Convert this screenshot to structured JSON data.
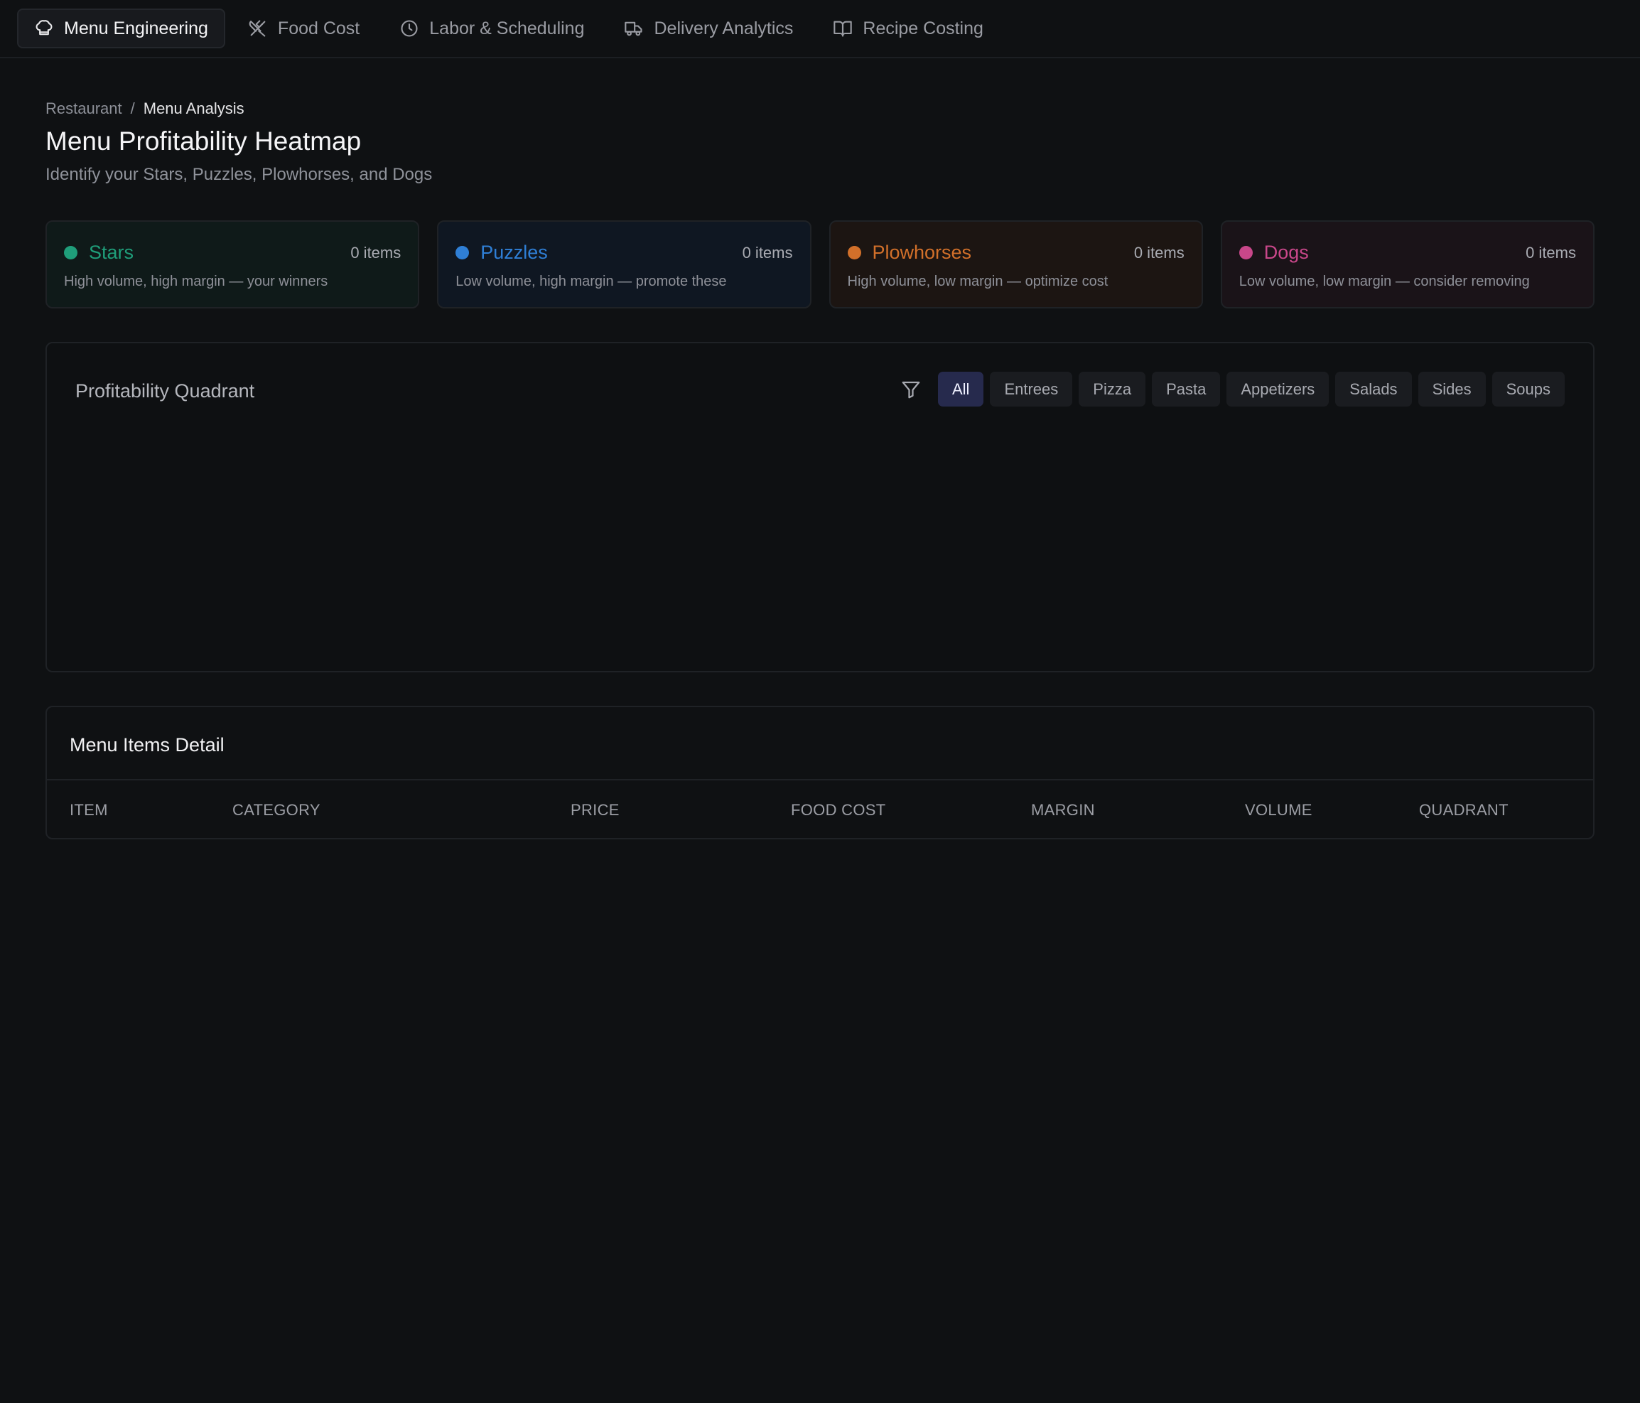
{
  "nav": {
    "tabs": [
      {
        "label": "Menu Engineering",
        "icon": "chef-hat-icon",
        "active": true
      },
      {
        "label": "Food Cost",
        "icon": "utensils-crossed-icon",
        "active": false
      },
      {
        "label": "Labor & Scheduling",
        "icon": "clock-icon",
        "active": false
      },
      {
        "label": "Delivery Analytics",
        "icon": "truck-icon",
        "active": false
      },
      {
        "label": "Recipe Costing",
        "icon": "book-open-icon",
        "active": false
      }
    ]
  },
  "breadcrumb": {
    "parent": "Restaurant",
    "separator": "/",
    "current": "Menu Analysis"
  },
  "page": {
    "title": "Menu Profitability Heatmap",
    "subtitle": "Identify your Stars, Puzzles, Plowhorses, and Dogs"
  },
  "summary": [
    {
      "name": "Stars",
      "count": "0 items",
      "description": "High volume, high margin — your winners",
      "color": "#1f9e7a",
      "bg": "#0f1a19"
    },
    {
      "name": "Puzzles",
      "count": "0 items",
      "description": "Low volume, high margin — promote these",
      "color": "#2f7fd6",
      "bg": "#0f1722"
    },
    {
      "name": "Plowhorses",
      "count": "0 items",
      "description": "High volume, low margin — optimize cost",
      "color": "#d2702a",
      "bg": "#1c1512"
    },
    {
      "name": "Dogs",
      "count": "0 items",
      "description": "Low volume, low margin — consider removing",
      "color": "#c9478a",
      "bg": "#1a1318"
    }
  ],
  "quadrant": {
    "title": "Profitability Quadrant",
    "filter_icon": "filter-icon",
    "filters": [
      {
        "label": "All",
        "active": true
      },
      {
        "label": "Entrees",
        "active": false
      },
      {
        "label": "Pizza",
        "active": false
      },
      {
        "label": "Pasta",
        "active": false
      },
      {
        "label": "Appetizers",
        "active": false
      },
      {
        "label": "Salads",
        "active": false
      },
      {
        "label": "Sides",
        "active": false
      },
      {
        "label": "Soups",
        "active": false
      }
    ]
  },
  "detail": {
    "title": "Menu Items Detail",
    "columns": [
      "ITEM",
      "CATEGORY",
      "PRICE",
      "FOOD COST",
      "MARGIN",
      "VOLUME",
      "QUADRANT"
    ]
  }
}
